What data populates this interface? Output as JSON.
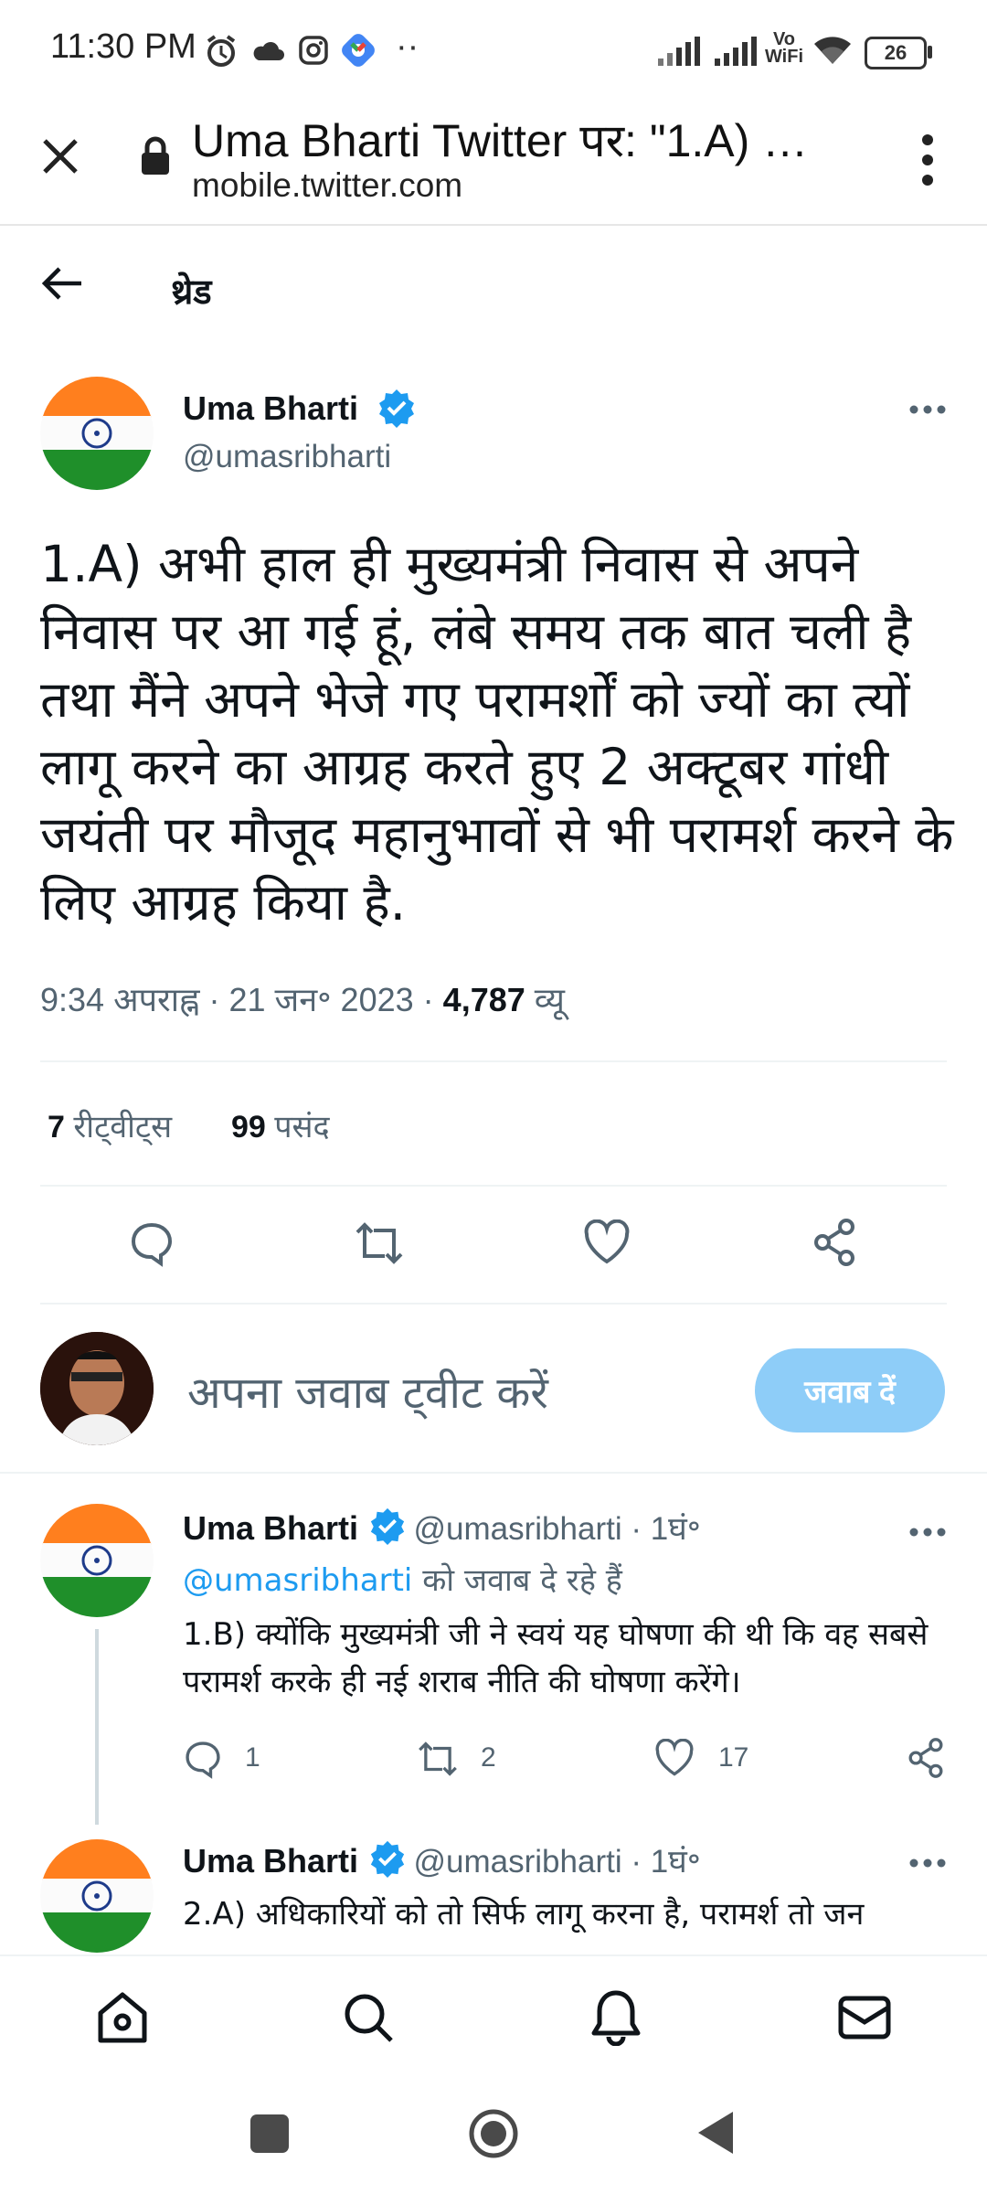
{
  "status_bar": {
    "time": "11:30 PM",
    "network": "Vo WiFi",
    "battery": "26"
  },
  "browser": {
    "title": "Uma Bharti Twitter पर: \"1.A) …",
    "url": "mobile.twitter.com"
  },
  "thread_header": {
    "label": "थ्रेड"
  },
  "main_tweet": {
    "author_name": "Uma Bharti",
    "handle": "@umasribharti",
    "text": "1.A) अभी हाल ही मुख्यमंत्री निवास से अपने निवास पर आ गई हूं, लंबे समय तक बात चली है तथा मैंने अपने भेजे गए परामर्शों  को ज्यों का त्यों लागू करने का आग्रह करते हुए 2 अक्टूबर गांधी जयंती पर मौजूद महानुभावों से भी परामर्श करने के लिए आग्रह किया है.",
    "time": "9:34 अपराह्न",
    "date": "21 जन॰ 2023",
    "views_count": "4,787",
    "views_label": "व्यू",
    "retweets_count": "7",
    "retweets_label": "रीट्वीट्स",
    "likes_count": "99",
    "likes_label": "पसंद"
  },
  "reply_box": {
    "placeholder": "अपना जवाब ट्वीट करें",
    "button_label": "जवाब दें"
  },
  "replies": [
    {
      "author_name": "Uma Bharti",
      "handle": "@umasribharti",
      "time": "1घं॰",
      "replying_to_handle": "@umasribharti",
      "replying_to_suffix": "को जवाब दे रहे हैं",
      "text": "1.B) क्योंकि मुख्यमंत्री जी ने स्वयं यह घोषणा की थी कि वह सबसे परामर्श करके ही नई शराब नीति की घोषणा करेंगे।",
      "reply_count": "1",
      "retweet_count": "2",
      "like_count": "17"
    },
    {
      "author_name": "Uma Bharti",
      "handle": "@umasribharti",
      "time": "1घं॰",
      "text": "2.A) अधिकारियों को तो सिर्फ लागू करना है, परामर्श तो जन"
    }
  ],
  "colors": {
    "verified": "#1d9bf0",
    "link": "#1d9bf0",
    "reply_button": "#8ecdf8",
    "secondary_text": "#536471"
  }
}
